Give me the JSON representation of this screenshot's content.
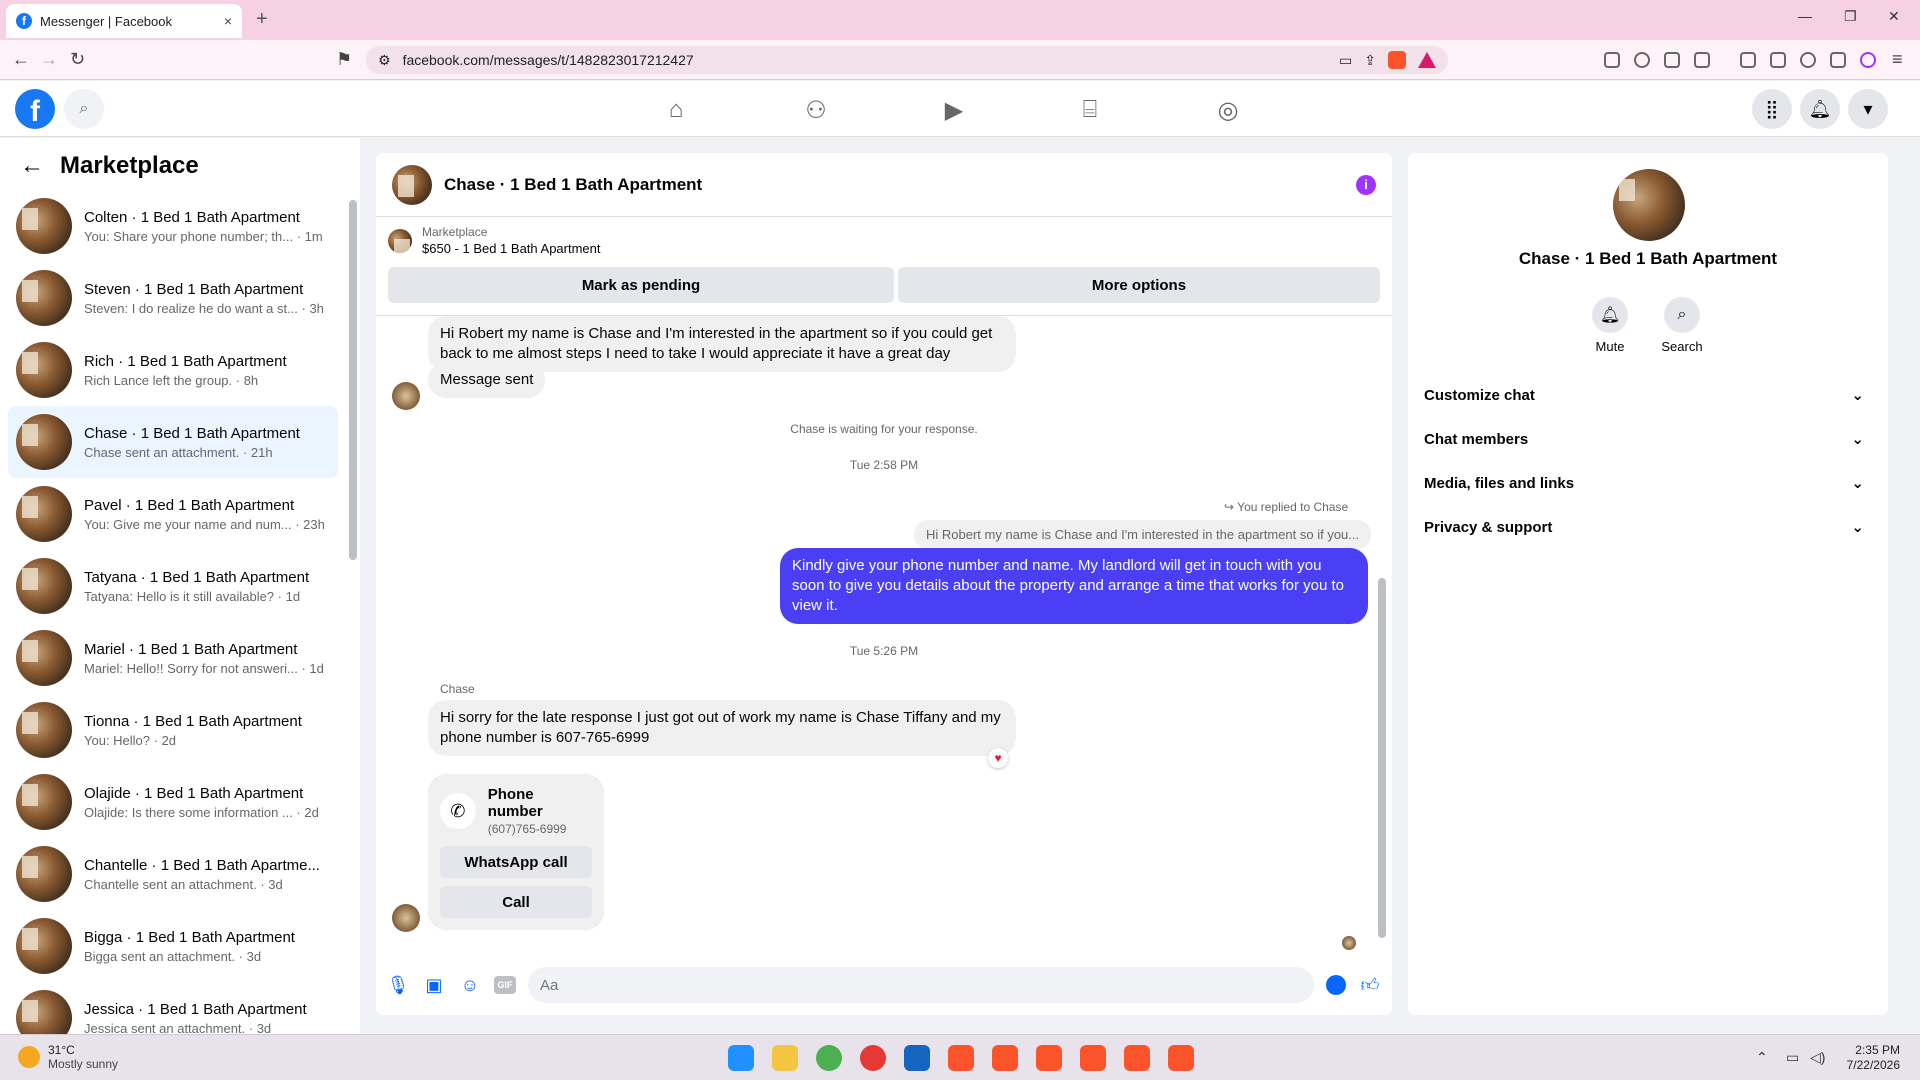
{
  "browser": {
    "tab_title": "Messenger | Facebook",
    "url": "facebook.com/messages/t/1482823017212427",
    "new_tab": "+",
    "close_tab": "×"
  },
  "fb": {
    "logo_letter": "f"
  },
  "sidebar": {
    "title": "Marketplace",
    "conversations": [
      {
        "name": "Colten · 1 Bed 1 Bath Apartment",
        "snippet": "You: Share your phone number; th... · 1m"
      },
      {
        "name": "Steven · 1 Bed 1 Bath Apartment",
        "snippet": "Steven: I do realize he do want a st... · 3h"
      },
      {
        "name": "Rich · 1 Bed 1 Bath Apartment",
        "snippet": "Rich Lance left the group. · 8h"
      },
      {
        "name": "Chase · 1 Bed 1 Bath Apartment",
        "snippet": "Chase sent an attachment. · 21h"
      },
      {
        "name": "Pavel · 1 Bed 1 Bath Apartment",
        "snippet": "You: Give me your name and num... · 23h"
      },
      {
        "name": "Tatyana · 1 Bed 1 Bath Apartment",
        "snippet": "Tatyana: Hello is it still available? · 1d"
      },
      {
        "name": "Mariel · 1 Bed 1 Bath Apartment",
        "snippet": "Mariel: Hello!! Sorry for not answeri... · 1d"
      },
      {
        "name": "Tionna · 1 Bed 1 Bath Apartment",
        "snippet": "You: Hello? · 2d"
      },
      {
        "name": "Olajide · 1 Bed 1 Bath Apartment",
        "snippet": "Olajide: Is there some information ... · 2d"
      },
      {
        "name": "Chantelle · 1 Bed 1 Bath Apartme...",
        "snippet": "Chantelle sent an attachment. · 3d"
      },
      {
        "name": "Bigga · 1 Bed 1 Bath Apartment",
        "snippet": "Bigga sent an attachment. · 3d"
      },
      {
        "name": "Jessica · 1 Bed 1 Bath Apartment",
        "snippet": "Jessica sent an attachment. · 3d"
      }
    ]
  },
  "chat": {
    "title": "Chase · 1 Bed 1 Bath Apartment",
    "marketplace_label": "Marketplace",
    "listing": "$650 - 1 Bed 1 Bath Apartment",
    "mark_pending": "Mark as pending",
    "more_options": "More options",
    "msg1": "Hi Robert my name is Chase and I'm interested in the apartment so if you could get back to me almost steps I need to take I would appreciate it have a great day",
    "msg2": "Message sent",
    "waiting": "Chase is waiting for your response.",
    "time1": "Tue 2:58 PM",
    "replied_note": "You replied to Chase",
    "quoted": "Hi Robert my name is Chase and I'm interested in the apartment so if you...",
    "out_msg": "Kindly give your phone number and name. My landlord will get in touch with you soon to give you details about the property and arrange a time that works for you to view it.",
    "time2": "Tue 5:26 PM",
    "sender": "Chase",
    "msg3": "Hi sorry for the late response I just got out of work my name is Chase Tiffany and my phone number is 607-765-6999",
    "card_title": "Phone number",
    "card_number": "(607)765-6999",
    "whatsapp": "WhatsApp call",
    "call": "Call",
    "input_placeholder": "Aa",
    "gif": "GIF"
  },
  "details": {
    "name": "Chase · 1 Bed 1 Bath Apartment",
    "mute": "Mute",
    "search": "Search",
    "sections": [
      "Customize chat",
      "Chat members",
      "Media, files and links",
      "Privacy & support"
    ]
  },
  "taskbar": {
    "temp": "31°C",
    "weather": "Mostly sunny",
    "time": "2:35 PM",
    "date": "7/22/2026"
  }
}
